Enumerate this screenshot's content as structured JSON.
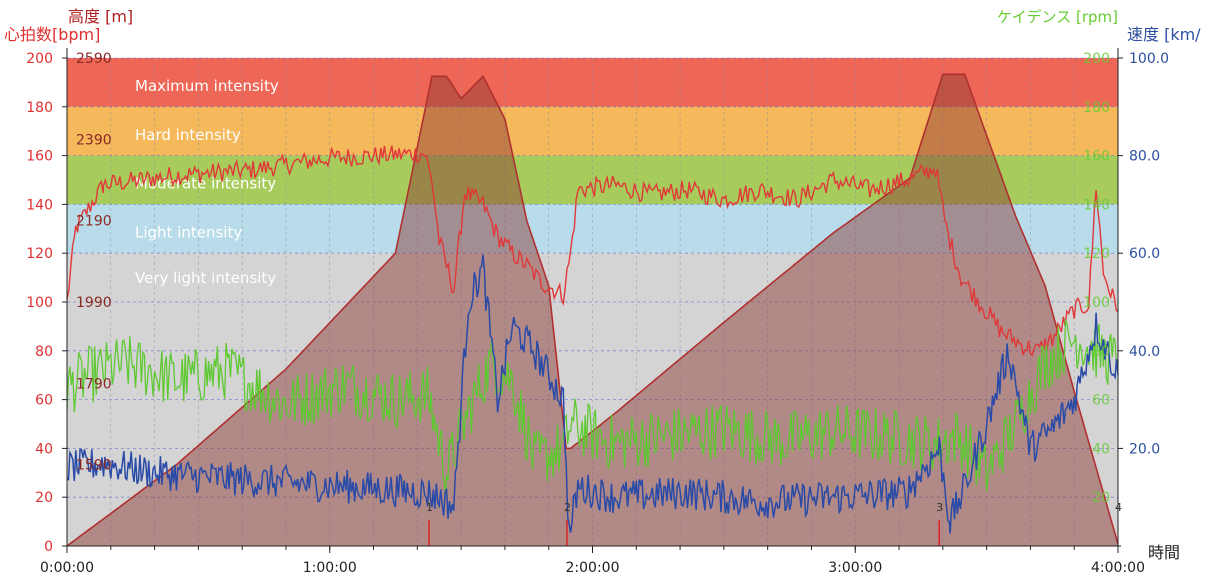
{
  "chart_data": {
    "type": "line",
    "x": {
      "label": "時間",
      "range_seconds": [
        0,
        14400
      ],
      "ticks": [
        "0:00:00",
        "1:00:00",
        "2:00:00",
        "3:00:00",
        "4:00:00"
      ]
    },
    "axes": {
      "heart_rate": {
        "label": "心拍数[bpm]",
        "color": "#e03030",
        "range": [
          0,
          200
        ],
        "ticks": [
          "0",
          "20",
          "40",
          "60",
          "80",
          "100",
          "120",
          "140",
          "160",
          "180",
          "200"
        ]
      },
      "altitude": {
        "label": "高度 [m]",
        "color": "#b02020",
        "range": [
          1390,
          2590
        ],
        "ticks": [
          "1590",
          "1790",
          "1990",
          "2190",
          "2390",
          "2590"
        ]
      },
      "cadence": {
        "label": "ケイデンス [rpm]",
        "color": "#66cc33",
        "range": [
          0,
          200
        ],
        "ticks": [
          "20",
          "40",
          "60",
          "80",
          "100",
          "120",
          "140",
          "160",
          "180",
          "200"
        ]
      },
      "speed": {
        "label": "速度 [km/",
        "color": "#2c4fa0",
        "range": [
          0,
          100
        ],
        "ticks": [
          "20.0",
          "40.0",
          "60.0",
          "80.0",
          "100.0"
        ]
      }
    },
    "zones": [
      {
        "label": "Maximum intensity",
        "from": 180,
        "to": 200,
        "color": "#ee6655"
      },
      {
        "label": "Hard intensity",
        "from": 160,
        "to": 180,
        "color": "#f5b85a"
      },
      {
        "label": "Moderate intensity",
        "from": 140,
        "to": 160,
        "color": "#a8cc5c"
      },
      {
        "label": "Light intensity",
        "from": 120,
        "to": 140,
        "color": "#b8dcea"
      },
      {
        "label": "Very light intensity",
        "from": 0,
        "to": 120,
        "color": "#d4d4d4"
      }
    ],
    "markers": [
      {
        "label": "1",
        "x": 4960
      },
      {
        "label": "2",
        "x": 6850
      },
      {
        "label": "3",
        "x": 11950
      },
      {
        "label": "4",
        "x": 14400
      }
    ],
    "series": [
      {
        "name": "高度",
        "axis": "altitude",
        "color": "#b03030",
        "x": [
          0,
          1500,
          3000,
          4500,
          5000,
          5200,
          5400,
          5700,
          6000,
          6300,
          6600,
          6840,
          6900,
          7500,
          9000,
          10500,
          11550,
          12000,
          12300,
          12600,
          13000,
          13400,
          13800,
          14400
        ],
        "y": [
          1390,
          1590,
          1825,
          2110,
          2545,
          2545,
          2490,
          2545,
          2440,
          2190,
          2030,
          1630,
          1630,
          1715,
          1940,
          2160,
          2295,
          2550,
          2550,
          2400,
          2200,
          2030,
          1770,
          1395
        ]
      },
      {
        "name": "心拍数",
        "axis": "heart_rate",
        "color": "#e03838",
        "x": [
          0,
          120,
          500,
          1500,
          2500,
          3600,
          4900,
          5000,
          5100,
          5300,
          5450,
          5700,
          5900,
          6100,
          6300,
          6500,
          6800,
          6900,
          7000,
          7500,
          8000,
          8500,
          9000,
          9500,
          10000,
          10500,
          11000,
          11500,
          11900,
          12050,
          12250,
          12500,
          12800,
          13100,
          13300,
          13500,
          13800,
          14000,
          14100,
          14200,
          14400
        ],
        "y": [
          100,
          130,
          148,
          152,
          154,
          159,
          161,
          150,
          125,
          105,
          145,
          140,
          127,
          120,
          115,
          108,
          103,
          120,
          146,
          148,
          144,
          146,
          142,
          146,
          142,
          150,
          146,
          150,
          155,
          130,
          110,
          100,
          88,
          82,
          80,
          85,
          97,
          99,
          148,
          112,
          96
        ]
      },
      {
        "name": "ケイデンス",
        "axis": "cadence",
        "color": "#5fc932",
        "x": [
          0,
          300,
          800,
          1500,
          2200,
          3000,
          3800,
          4500,
          4950,
          5200,
          5500,
          5800,
          6100,
          6400,
          6800,
          6900,
          7500,
          8200,
          9000,
          9800,
          10500,
          11200,
          11900,
          12200,
          12600,
          13000,
          13400,
          13800,
          14100,
          14400
        ],
        "y": [
          65,
          70,
          75,
          68,
          72,
          58,
          66,
          60,
          62,
          30,
          55,
          75,
          68,
          35,
          40,
          50,
          42,
          45,
          48,
          43,
          47,
          45,
          42,
          45,
          30,
          50,
          75,
          85,
          80,
          75
        ]
      },
      {
        "name": "速度",
        "axis": "speed",
        "color": "#2a4aa8",
        "x": [
          0,
          500,
          1200,
          2000,
          3000,
          4000,
          4900,
          5100,
          5300,
          5500,
          5700,
          5900,
          6100,
          6400,
          6800,
          6880,
          7000,
          7500,
          8500,
          9500,
          10500,
          11500,
          11950,
          12100,
          12300,
          12600,
          12900,
          13200,
          13500,
          13800,
          14100,
          14400
        ],
        "y": [
          16,
          17,
          15,
          14,
          13,
          12,
          11,
          10,
          8,
          50,
          57,
          30,
          45,
          40,
          30,
          2,
          12,
          10,
          11,
          9,
          10,
          11,
          20,
          5,
          12,
          25,
          40,
          20,
          24,
          30,
          45,
          35
        ]
      }
    ]
  }
}
